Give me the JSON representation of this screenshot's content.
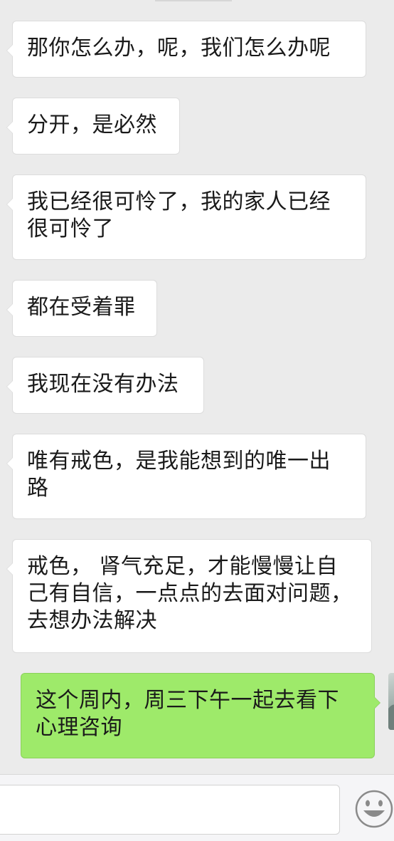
{
  "messages": [
    {
      "side": "received",
      "text": "那你怎么办，呢，我们怎么办呢"
    },
    {
      "side": "received",
      "text": "分开，是必然"
    },
    {
      "side": "received",
      "text": "我已经很可怜了，我的家人已经很可怜了"
    },
    {
      "side": "received",
      "text": "都在受着罪"
    },
    {
      "side": "received",
      "text": "我现在没有办法"
    },
    {
      "side": "received",
      "text": "唯有戒色，是我能想到的唯一出路"
    },
    {
      "side": "received",
      "text": "戒色， 肾气充足，才能慢慢让自己有自信，一点点的去面对问题，去想办法解决"
    },
    {
      "side": "sent",
      "text": "这个周内，周三下午一起去看下心理咨询"
    }
  ],
  "input": {
    "value": "",
    "placeholder": ""
  },
  "icons": {
    "emoji": "emoji-smiley-icon",
    "avatar": "user-avatar"
  },
  "colors": {
    "chat_background": "#ebebeb",
    "received_bubble": "#ffffff",
    "sent_bubble": "#9eea6a",
    "input_bar": "#f5f5f7"
  }
}
